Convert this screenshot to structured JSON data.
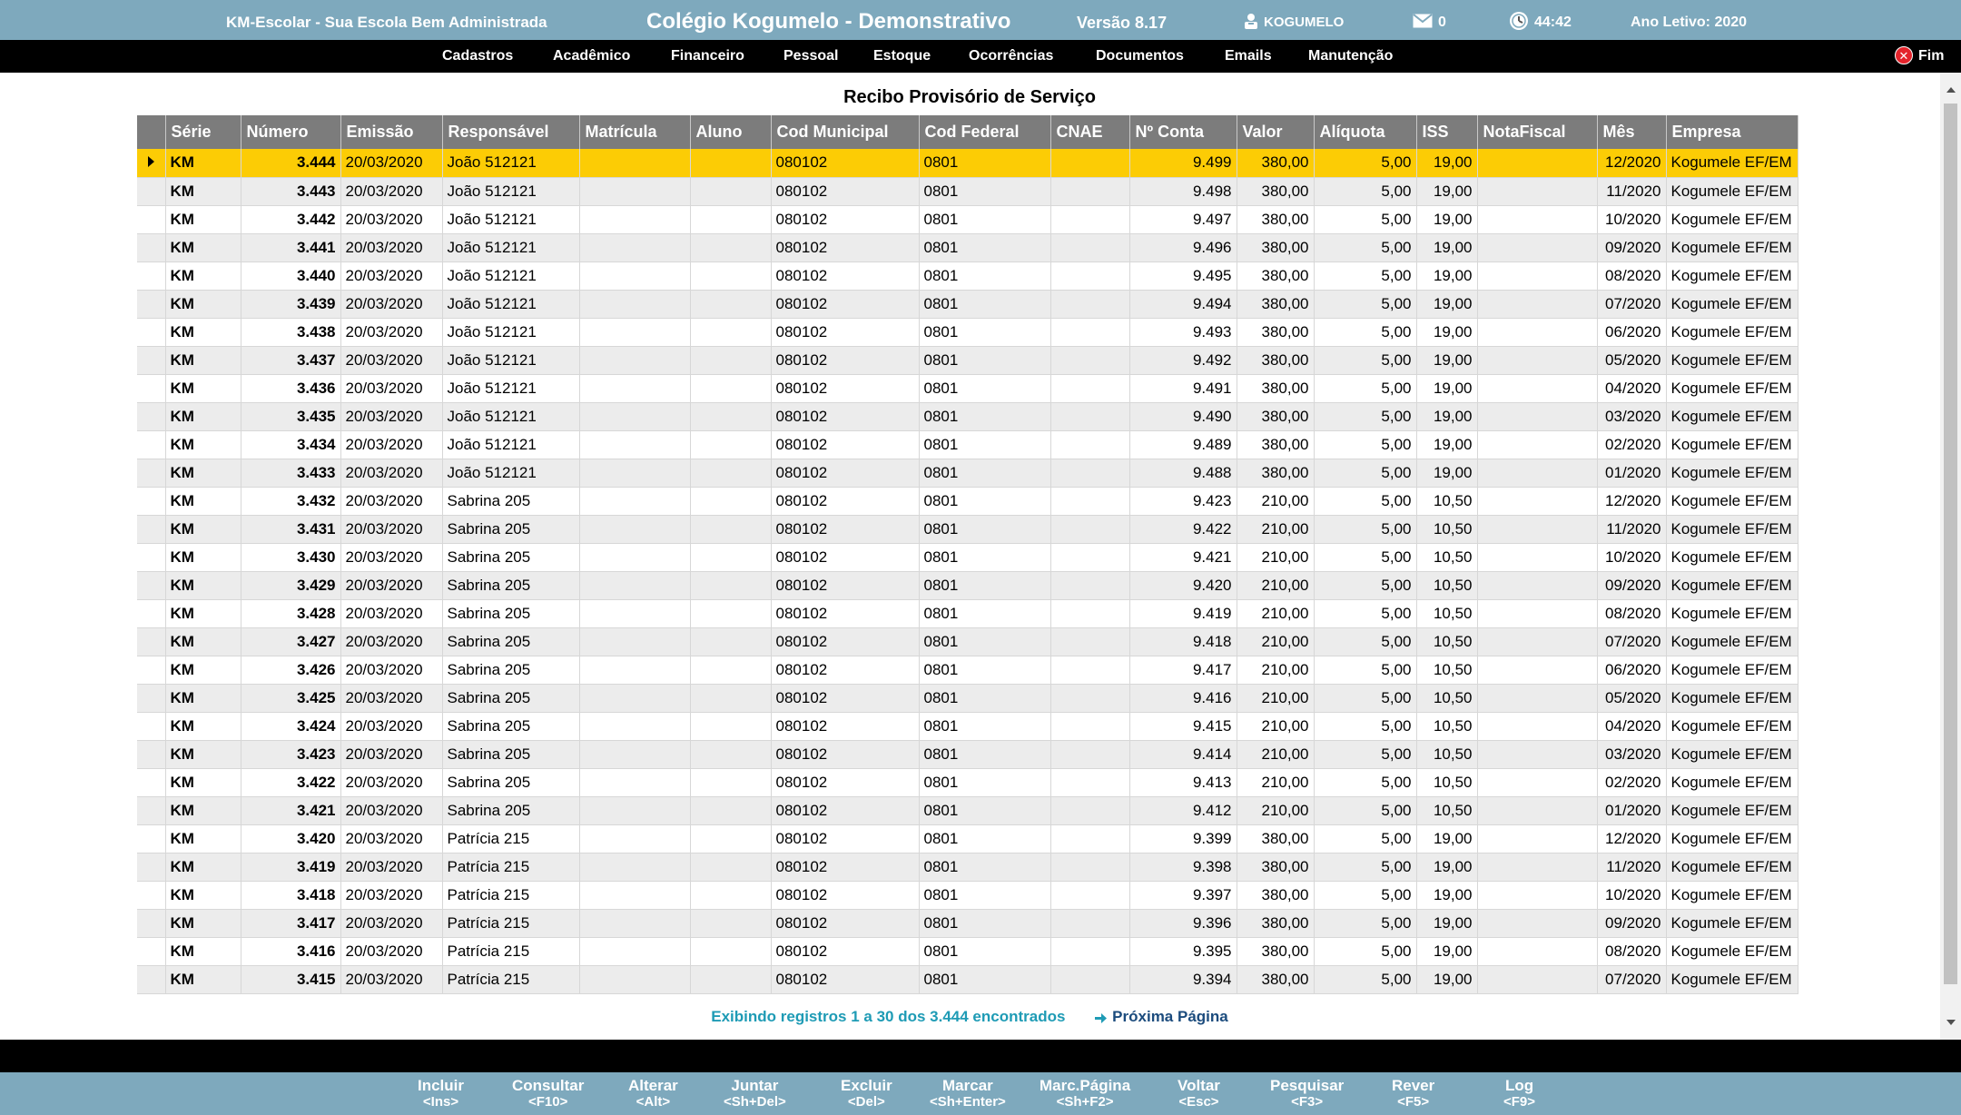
{
  "header": {
    "app_name": "KM-Escolar - Sua Escola Bem Administrada",
    "school": "Colégio Kogumelo - Demonstrativo",
    "version": "Versão 8.17",
    "user": "KOGUMELO",
    "messages": "0",
    "session_time": "44:42",
    "school_year": "Ano Letivo: 2020"
  },
  "menu": {
    "items": [
      "Cadastros",
      "Acadêmico",
      "Financeiro",
      "Pessoal",
      "Estoque",
      "Ocorrências",
      "Documentos",
      "Emails",
      "Manutenção"
    ],
    "exit_label": "Fim"
  },
  "page": {
    "title": "Recibo Provisório de Serviço"
  },
  "table": {
    "columns": [
      "Série",
      "Número",
      "Emissão",
      "Responsável",
      "Matrícula",
      "Aluno",
      "Cod Municipal",
      "Cod Federal",
      "CNAE",
      "Nº Conta",
      "Valor",
      "Alíquota",
      "ISS",
      "NotaFiscal",
      "Mês",
      "Empresa"
    ],
    "selected_row": 0,
    "rows": [
      [
        "KM",
        "3.444",
        "20/03/2020",
        "João 512121",
        "",
        "",
        "080102",
        "0801",
        "",
        "9.499",
        "380,00",
        "5,00",
        "19,00",
        "",
        "12/2020",
        "Kogumele EF/EM"
      ],
      [
        "KM",
        "3.443",
        "20/03/2020",
        "João 512121",
        "",
        "",
        "080102",
        "0801",
        "",
        "9.498",
        "380,00",
        "5,00",
        "19,00",
        "",
        "11/2020",
        "Kogumele EF/EM"
      ],
      [
        "KM",
        "3.442",
        "20/03/2020",
        "João 512121",
        "",
        "",
        "080102",
        "0801",
        "",
        "9.497",
        "380,00",
        "5,00",
        "19,00",
        "",
        "10/2020",
        "Kogumele EF/EM"
      ],
      [
        "KM",
        "3.441",
        "20/03/2020",
        "João 512121",
        "",
        "",
        "080102",
        "0801",
        "",
        "9.496",
        "380,00",
        "5,00",
        "19,00",
        "",
        "09/2020",
        "Kogumele EF/EM"
      ],
      [
        "KM",
        "3.440",
        "20/03/2020",
        "João 512121",
        "",
        "",
        "080102",
        "0801",
        "",
        "9.495",
        "380,00",
        "5,00",
        "19,00",
        "",
        "08/2020",
        "Kogumele EF/EM"
      ],
      [
        "KM",
        "3.439",
        "20/03/2020",
        "João 512121",
        "",
        "",
        "080102",
        "0801",
        "",
        "9.494",
        "380,00",
        "5,00",
        "19,00",
        "",
        "07/2020",
        "Kogumele EF/EM"
      ],
      [
        "KM",
        "3.438",
        "20/03/2020",
        "João 512121",
        "",
        "",
        "080102",
        "0801",
        "",
        "9.493",
        "380,00",
        "5,00",
        "19,00",
        "",
        "06/2020",
        "Kogumele EF/EM"
      ],
      [
        "KM",
        "3.437",
        "20/03/2020",
        "João 512121",
        "",
        "",
        "080102",
        "0801",
        "",
        "9.492",
        "380,00",
        "5,00",
        "19,00",
        "",
        "05/2020",
        "Kogumele EF/EM"
      ],
      [
        "KM",
        "3.436",
        "20/03/2020",
        "João 512121",
        "",
        "",
        "080102",
        "0801",
        "",
        "9.491",
        "380,00",
        "5,00",
        "19,00",
        "",
        "04/2020",
        "Kogumele EF/EM"
      ],
      [
        "KM",
        "3.435",
        "20/03/2020",
        "João 512121",
        "",
        "",
        "080102",
        "0801",
        "",
        "9.490",
        "380,00",
        "5,00",
        "19,00",
        "",
        "03/2020",
        "Kogumele EF/EM"
      ],
      [
        "KM",
        "3.434",
        "20/03/2020",
        "João 512121",
        "",
        "",
        "080102",
        "0801",
        "",
        "9.489",
        "380,00",
        "5,00",
        "19,00",
        "",
        "02/2020",
        "Kogumele EF/EM"
      ],
      [
        "KM",
        "3.433",
        "20/03/2020",
        "João 512121",
        "",
        "",
        "080102",
        "0801",
        "",
        "9.488",
        "380,00",
        "5,00",
        "19,00",
        "",
        "01/2020",
        "Kogumele EF/EM"
      ],
      [
        "KM",
        "3.432",
        "20/03/2020",
        "Sabrina 205",
        "",
        "",
        "080102",
        "0801",
        "",
        "9.423",
        "210,00",
        "5,00",
        "10,50",
        "",
        "12/2020",
        "Kogumele EF/EM"
      ],
      [
        "KM",
        "3.431",
        "20/03/2020",
        "Sabrina 205",
        "",
        "",
        "080102",
        "0801",
        "",
        "9.422",
        "210,00",
        "5,00",
        "10,50",
        "",
        "11/2020",
        "Kogumele EF/EM"
      ],
      [
        "KM",
        "3.430",
        "20/03/2020",
        "Sabrina 205",
        "",
        "",
        "080102",
        "0801",
        "",
        "9.421",
        "210,00",
        "5,00",
        "10,50",
        "",
        "10/2020",
        "Kogumele EF/EM"
      ],
      [
        "KM",
        "3.429",
        "20/03/2020",
        "Sabrina 205",
        "",
        "",
        "080102",
        "0801",
        "",
        "9.420",
        "210,00",
        "5,00",
        "10,50",
        "",
        "09/2020",
        "Kogumele EF/EM"
      ],
      [
        "KM",
        "3.428",
        "20/03/2020",
        "Sabrina 205",
        "",
        "",
        "080102",
        "0801",
        "",
        "9.419",
        "210,00",
        "5,00",
        "10,50",
        "",
        "08/2020",
        "Kogumele EF/EM"
      ],
      [
        "KM",
        "3.427",
        "20/03/2020",
        "Sabrina 205",
        "",
        "",
        "080102",
        "0801",
        "",
        "9.418",
        "210,00",
        "5,00",
        "10,50",
        "",
        "07/2020",
        "Kogumele EF/EM"
      ],
      [
        "KM",
        "3.426",
        "20/03/2020",
        "Sabrina 205",
        "",
        "",
        "080102",
        "0801",
        "",
        "9.417",
        "210,00",
        "5,00",
        "10,50",
        "",
        "06/2020",
        "Kogumele EF/EM"
      ],
      [
        "KM",
        "3.425",
        "20/03/2020",
        "Sabrina 205",
        "",
        "",
        "080102",
        "0801",
        "",
        "9.416",
        "210,00",
        "5,00",
        "10,50",
        "",
        "05/2020",
        "Kogumele EF/EM"
      ],
      [
        "KM",
        "3.424",
        "20/03/2020",
        "Sabrina 205",
        "",
        "",
        "080102",
        "0801",
        "",
        "9.415",
        "210,00",
        "5,00",
        "10,50",
        "",
        "04/2020",
        "Kogumele EF/EM"
      ],
      [
        "KM",
        "3.423",
        "20/03/2020",
        "Sabrina 205",
        "",
        "",
        "080102",
        "0801",
        "",
        "9.414",
        "210,00",
        "5,00",
        "10,50",
        "",
        "03/2020",
        "Kogumele EF/EM"
      ],
      [
        "KM",
        "3.422",
        "20/03/2020",
        "Sabrina 205",
        "",
        "",
        "080102",
        "0801",
        "",
        "9.413",
        "210,00",
        "5,00",
        "10,50",
        "",
        "02/2020",
        "Kogumele EF/EM"
      ],
      [
        "KM",
        "3.421",
        "20/03/2020",
        "Sabrina 205",
        "",
        "",
        "080102",
        "0801",
        "",
        "9.412",
        "210,00",
        "5,00",
        "10,50",
        "",
        "01/2020",
        "Kogumele EF/EM"
      ],
      [
        "KM",
        "3.420",
        "20/03/2020",
        "Patrícia 215",
        "",
        "",
        "080102",
        "0801",
        "",
        "9.399",
        "380,00",
        "5,00",
        "19,00",
        "",
        "12/2020",
        "Kogumele EF/EM"
      ],
      [
        "KM",
        "3.419",
        "20/03/2020",
        "Patrícia 215",
        "",
        "",
        "080102",
        "0801",
        "",
        "9.398",
        "380,00",
        "5,00",
        "19,00",
        "",
        "11/2020",
        "Kogumele EF/EM"
      ],
      [
        "KM",
        "3.418",
        "20/03/2020",
        "Patrícia 215",
        "",
        "",
        "080102",
        "0801",
        "",
        "9.397",
        "380,00",
        "5,00",
        "19,00",
        "",
        "10/2020",
        "Kogumele EF/EM"
      ],
      [
        "KM",
        "3.417",
        "20/03/2020",
        "Patrícia 215",
        "",
        "",
        "080102",
        "0801",
        "",
        "9.396",
        "380,00",
        "5,00",
        "19,00",
        "",
        "09/2020",
        "Kogumele EF/EM"
      ],
      [
        "KM",
        "3.416",
        "20/03/2020",
        "Patrícia 215",
        "",
        "",
        "080102",
        "0801",
        "",
        "9.395",
        "380,00",
        "5,00",
        "19,00",
        "",
        "08/2020",
        "Kogumele EF/EM"
      ],
      [
        "KM",
        "3.415",
        "20/03/2020",
        "Patrícia 215",
        "",
        "",
        "080102",
        "0801",
        "",
        "9.394",
        "380,00",
        "5,00",
        "19,00",
        "",
        "07/2020",
        "Kogumele EF/EM"
      ]
    ]
  },
  "pager": {
    "info": "Exibindo registros 1 a 30 dos 3.444 encontrados",
    "next_label": "Próxima Página"
  },
  "footer": {
    "buttons": [
      {
        "label": "Incluir",
        "key": "<Ins>"
      },
      {
        "label": "Consultar",
        "key": "<F10>"
      },
      {
        "label": "Alterar",
        "key": "<Alt>"
      },
      {
        "label": "Juntar",
        "key": "<Sh+Del>"
      },
      {
        "label": "Excluir",
        "key": "<Del>"
      },
      {
        "label": "Marcar",
        "key": "<Sh+Enter>"
      },
      {
        "label": "Marc.Página",
        "key": "<Sh+F2>"
      },
      {
        "label": "Voltar",
        "key": "<Esc>"
      },
      {
        "label": "Pesquisar",
        "key": "<F3>"
      },
      {
        "label": "Rever",
        "key": "<F5>"
      },
      {
        "label": "Log",
        "key": "<F9>"
      }
    ]
  },
  "icons": {
    "user": "user-icon",
    "messages": "envelope-icon",
    "clock": "clock-icon",
    "exit": "close-circle-icon",
    "next": "arrow-right-icon"
  },
  "colors": {
    "header_bg": "#7ea9bd",
    "menu_bg": "#000000",
    "selected_row": "#fccc05",
    "grid_header": "#7c7c7c",
    "pager_info": "#1e9bb5"
  }
}
